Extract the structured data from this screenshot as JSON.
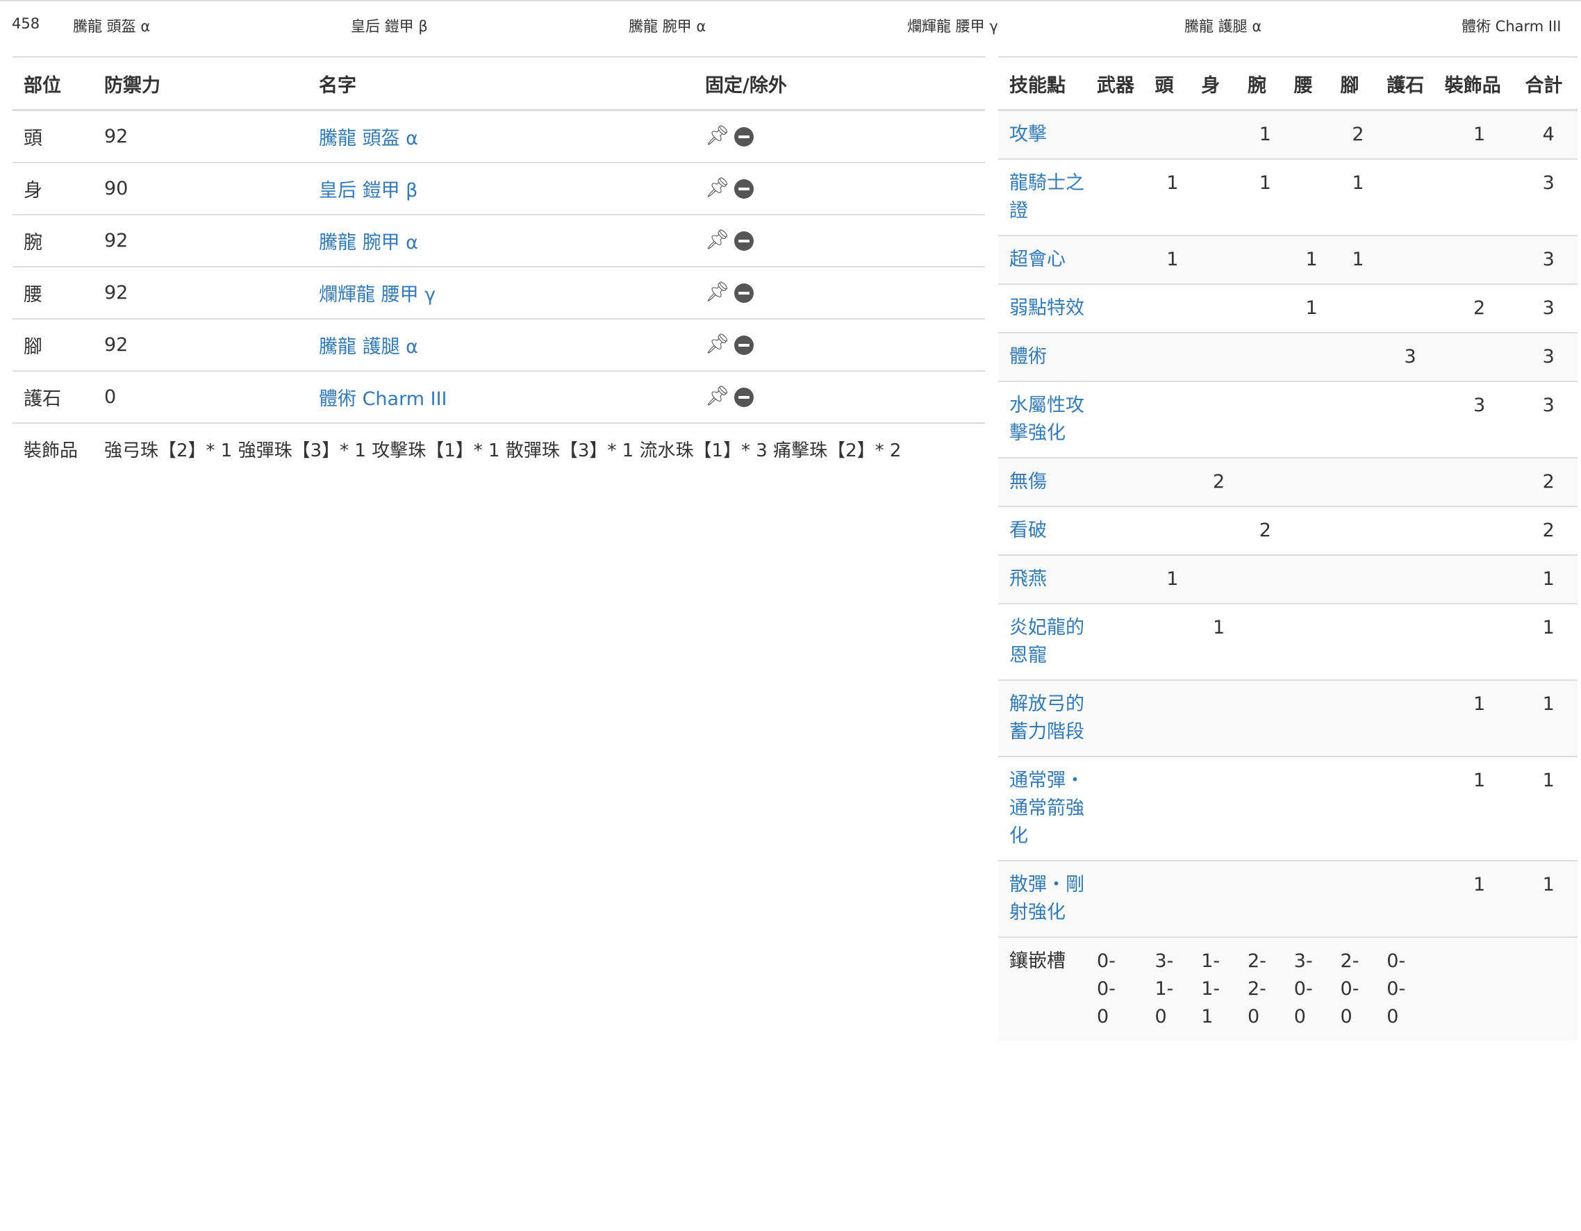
{
  "summary": {
    "total_defense": "458",
    "pieces": [
      "騰龍 頭盔 α",
      "皇后 鎧甲 β",
      "騰龍 腕甲 α",
      "爛輝龍 腰甲 γ",
      "騰龍 護腿 α",
      "體術 Charm III"
    ]
  },
  "armor_table": {
    "headers": [
      "部位",
      "防禦力",
      "名字",
      "固定/除外"
    ],
    "rows": [
      {
        "part": "頭",
        "defense": "92",
        "name": "騰龍 頭盔 α"
      },
      {
        "part": "身",
        "defense": "90",
        "name": "皇后 鎧甲 β"
      },
      {
        "part": "腕",
        "defense": "92",
        "name": "騰龍 腕甲 α"
      },
      {
        "part": "腰",
        "defense": "92",
        "name": "爛輝龍 腰甲 γ"
      },
      {
        "part": "腳",
        "defense": "92",
        "name": "騰龍 護腿 α"
      },
      {
        "part": "護石",
        "defense": "0",
        "name": "體術 Charm III"
      }
    ],
    "decorations_label": "裝飾品",
    "decorations": "強弓珠【2】* 1 強彈珠【3】* 1 攻擊珠【1】* 1 散彈珠【3】* 1 流水珠【1】* 3 痛擊珠【2】* 2"
  },
  "skills_table": {
    "headers": [
      "技能點",
      "武器",
      "頭",
      "身",
      "腕",
      "腰",
      "腳",
      "護石",
      "裝飾品",
      "合計"
    ],
    "rows": [
      {
        "skill": "攻擊",
        "vals": [
          "",
          "",
          "",
          "1",
          "",
          "2",
          "",
          "1",
          "4"
        ]
      },
      {
        "skill": "龍騎士之證",
        "vals": [
          "",
          "1",
          "",
          "1",
          "",
          "1",
          "",
          "",
          "3"
        ]
      },
      {
        "skill": "超會心",
        "vals": [
          "",
          "1",
          "",
          "",
          "1",
          "1",
          "",
          "",
          "3"
        ]
      },
      {
        "skill": "弱點特效",
        "vals": [
          "",
          "",
          "",
          "",
          "1",
          "",
          "",
          "2",
          "3"
        ]
      },
      {
        "skill": "體術",
        "vals": [
          "",
          "",
          "",
          "",
          "",
          "",
          "3",
          "",
          "3"
        ]
      },
      {
        "skill": "水屬性攻擊強化",
        "vals": [
          "",
          "",
          "",
          "",
          "",
          "",
          "",
          "3",
          "3"
        ]
      },
      {
        "skill": "無傷",
        "vals": [
          "",
          "",
          "2",
          "",
          "",
          "",
          "",
          "",
          "2"
        ]
      },
      {
        "skill": "看破",
        "vals": [
          "",
          "",
          "",
          "2",
          "",
          "",
          "",
          "",
          "2"
        ]
      },
      {
        "skill": "飛燕",
        "vals": [
          "",
          "1",
          "",
          "",
          "",
          "",
          "",
          "",
          "1"
        ]
      },
      {
        "skill": "炎妃龍的恩寵",
        "vals": [
          "",
          "",
          "1",
          "",
          "",
          "",
          "",
          "",
          "1"
        ]
      },
      {
        "skill": "解放弓的蓄力階段",
        "vals": [
          "",
          "",
          "",
          "",
          "",
          "",
          "",
          "1",
          "1"
        ]
      },
      {
        "skill": "通常彈・通常箭強化",
        "vals": [
          "",
          "",
          "",
          "",
          "",
          "",
          "",
          "1",
          "1"
        ]
      },
      {
        "skill": "散彈・剛射強化",
        "vals": [
          "",
          "",
          "",
          "",
          "",
          "",
          "",
          "1",
          "1"
        ]
      }
    ],
    "slots_label": "鑲嵌槽",
    "slots": [
      "0-0-0",
      "3-1-0",
      "1-1-1",
      "2-2-0",
      "3-0-0",
      "2-0-0",
      "0-0-0"
    ]
  }
}
